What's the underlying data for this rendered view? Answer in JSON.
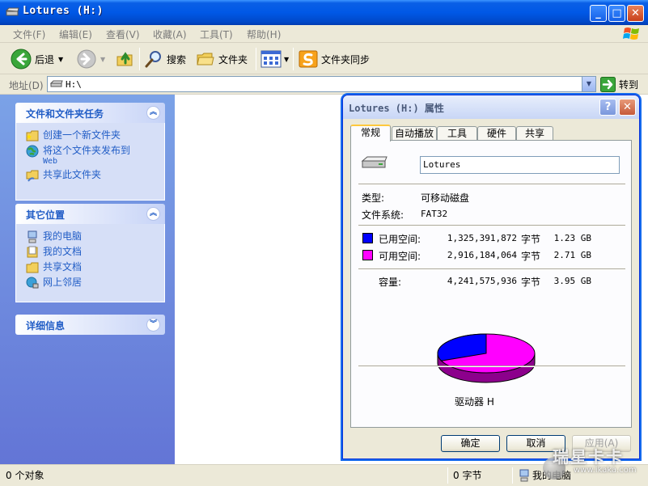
{
  "window": {
    "title": "Lotures  (H:)",
    "buttons": {
      "minimize": "_",
      "maximize": "□",
      "close": "✕"
    }
  },
  "menu": [
    "文件(F)",
    "编辑(E)",
    "查看(V)",
    "收藏(A)",
    "工具(T)",
    "帮助(H)"
  ],
  "toolbar": {
    "back": "后退",
    "search": "搜索",
    "folders": "文件夹",
    "sync": "文件夹同步"
  },
  "address": {
    "label": "地址(D)",
    "value": "H:\\",
    "go": "转到"
  },
  "sidebar": {
    "tasks": {
      "title": "文件和文件夹任务",
      "items": [
        {
          "label": "创建一个新文件夹",
          "sub": ""
        },
        {
          "label": "将这个文件夹发布到",
          "sub": "Web"
        },
        {
          "label": "共享此文件夹",
          "sub": ""
        }
      ]
    },
    "places": {
      "title": "其它位置",
      "items": [
        "我的电脑",
        "我的文档",
        "共享文档",
        "网上邻居"
      ]
    },
    "details": {
      "title": "详细信息"
    }
  },
  "status": {
    "objects": "0 个对象",
    "size": "0 字节",
    "location": "我的电脑"
  },
  "dialog": {
    "title": "Lotures (H:) 属性",
    "tabs": [
      "常规",
      "自动播放",
      "工具",
      "硬件",
      "共享"
    ],
    "label_value": "Lotures",
    "type_label": "类型:",
    "type_value": "可移动磁盘",
    "fs_label": "文件系统:",
    "fs_value": "FAT32",
    "used": {
      "label": "已用空间:",
      "bytes": "1,325,391,872",
      "unit": "字节",
      "size": "1.23 GB",
      "color": "#0000ff"
    },
    "free": {
      "label": "可用空间:",
      "bytes": "2,916,184,064",
      "unit": "字节",
      "size": "2.71 GB",
      "color": "#ff00ff"
    },
    "capacity": {
      "label": "容量:",
      "bytes": "4,241,575,936",
      "unit": "字节",
      "size": "3.95 GB"
    },
    "used_fraction": 0.3125,
    "drive_label": "驱动器 H",
    "buttons": {
      "ok": "确定",
      "cancel": "取消",
      "apply": "应用(A)"
    }
  },
  "watermark": {
    "brand": "瑞星卡卡",
    "url": "www.ikaka.com"
  }
}
